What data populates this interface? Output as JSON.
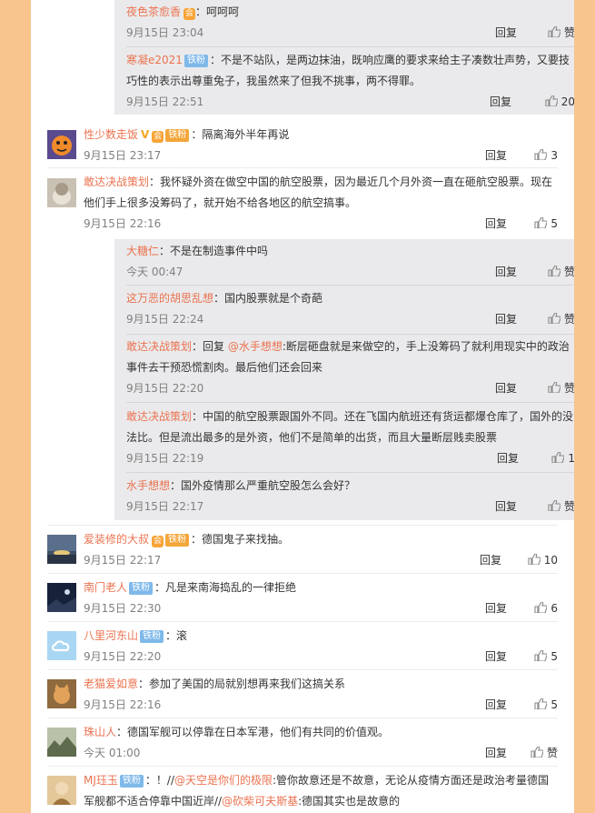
{
  "ui": {
    "reply_label": "回复",
    "like_label": "赞"
  },
  "thread0": {
    "replies": [
      {
        "name": "夜色茶愈香",
        "text": "：呵呵呵",
        "time": "9月15日 23:04",
        "likes": "赞"
      },
      {
        "name": "寒凝e2021",
        "badge": "铁粉",
        "text": "：不是不站队，是两边抹油，既响应鹰的要求来给主子凑数壮声势，又要技巧性的表示出尊重兔子，我虽然来了但我不挑事，两不得罪。",
        "time": "9月15日 22:51",
        "likes": "20"
      }
    ]
  },
  "comments": [
    {
      "name": "性少数走饭",
      "badge": "铁粉",
      "text": "：隔离海外半年再说",
      "time": "9月15日 23:17",
      "likes": "3"
    },
    {
      "name": "敢达决战策划",
      "text": "：我怀疑外资在做空中国的航空股票，因为最近几个月外资一直在砸航空股票。现在他们手上很多没筹码了，就开始不给各地区的航空搞事。",
      "time": "9月15日 22:16",
      "likes": "5"
    },
    {
      "name": "爱装修的大叔",
      "badge": "铁粉",
      "text": "：德国鬼子来找抽。",
      "time": "9月15日 22:17",
      "likes": "10"
    },
    {
      "name": "南门老人",
      "badge": "铁粉",
      "text": "：凡是来南海捣乱的一律拒绝",
      "time": "9月15日 22:30",
      "likes": "6"
    },
    {
      "name": "八里河东山",
      "badge": "铁粉",
      "text": "：滚",
      "time": "9月15日 22:20",
      "likes": "5"
    },
    {
      "name": "老猫爱如意",
      "text": "：参加了美国的局就别想再来我们这搞关系",
      "time": "9月15日 22:16",
      "likes": "5"
    },
    {
      "name": "珠山人",
      "text": "：德国军舰可以停靠在日本军港，他们有共同的价值观。",
      "time": "今天 01:00",
      "likes": "赞"
    },
    {
      "name": "MJ珏玉",
      "badge": "铁粉",
      "text_a": "：！//",
      "mention_a": "@天空是你们的极限",
      "text_b": ":管你故意还是不故意，无论从疫情方面还是政治考量德国军舰都不适合停靠中国近岸//",
      "mention_b": "@砍柴可夫斯基",
      "text_c": ":德国其实也是故意的"
    }
  ],
  "thread1": {
    "replies": [
      {
        "name": "大糖仁",
        "text": "：不是在制造事件中吗",
        "time": "今天 00:47",
        "likes": "赞"
      },
      {
        "name": "这万恶的胡思乱想",
        "text": "：国内股票就是个奇葩",
        "time": "9月15日 22:24",
        "likes": "赞"
      },
      {
        "name": "敢达决战策划",
        "text_a": "：回复 ",
        "mention": "@水手想想",
        "text_b": ":断层砸盘就是来做空的，手上没筹码了就利用现实中的政治事件去干预恐慌割肉。最后他们还会回来",
        "time": "9月15日 22:20",
        "likes": "赞"
      },
      {
        "name": "敢达决战策划",
        "text": "：中国的航空股票跟国外不同。还在飞国内航班还有货运都爆仓库了，国外的没法比。但是流出最多的是外资，他们不是简单的出货，而且大量断层贱卖股票",
        "time": "9月15日 22:19",
        "likes": "1"
      },
      {
        "name": "水手想想",
        "text": "：国外疫情那么严重航空股怎么会好？",
        "time": "9月15日 22:17",
        "likes": "赞"
      }
    ]
  },
  "colors": {
    "page_bg": "#f8c58f",
    "name": "#eb7350",
    "reply_box": "#eaeaec",
    "badge": "#7fb9ea"
  }
}
